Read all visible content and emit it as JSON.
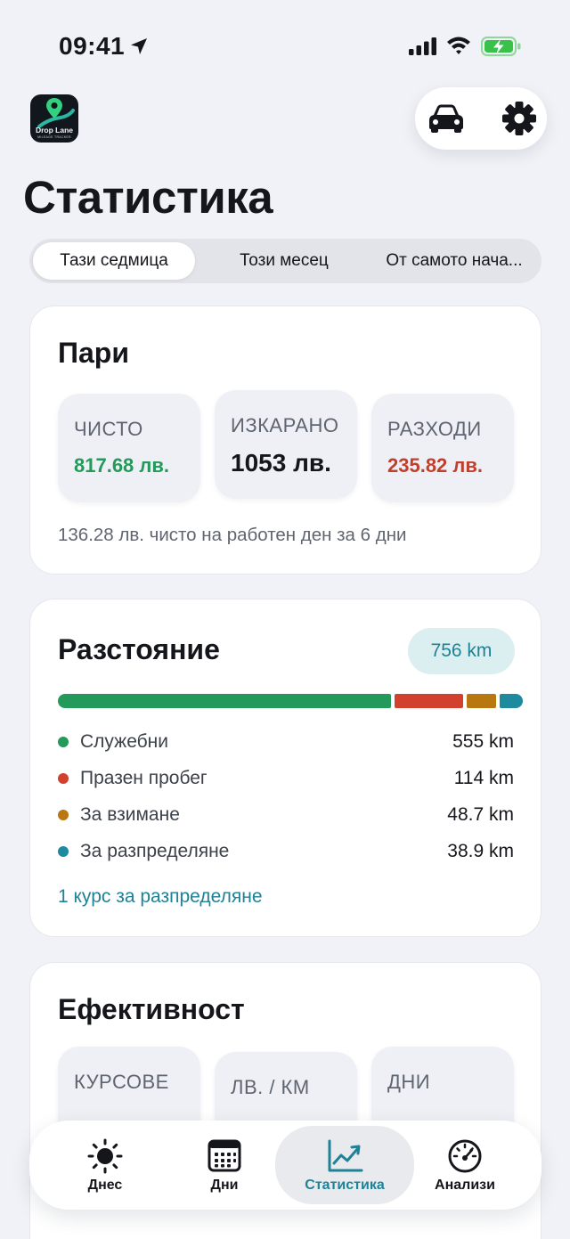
{
  "status_bar": {
    "time": "09:41"
  },
  "app": {
    "logo_name": "Drop Lane",
    "logo_subtitle": "MILEAGE TRACKER"
  },
  "page": {
    "title": "Статистика"
  },
  "period_tabs": [
    {
      "label": "Тази седмица",
      "active": true
    },
    {
      "label": "Този месец",
      "active": false
    },
    {
      "label": "От самото нача...",
      "active": false
    }
  ],
  "money": {
    "title": "Пари",
    "net_label": "ЧИСТО",
    "net_value": "817.68 лв.",
    "earned_label": "ИЗКАРАНО",
    "earned_value": "1053 лв.",
    "expenses_label": "РАЗХОДИ",
    "expenses_value": "235.82 лв.",
    "footnote": "136.28 лв. чисто на работен ден за 6 дни"
  },
  "distance": {
    "title": "Разстояние",
    "total": "756 km",
    "items": [
      {
        "label": "Служебни",
        "value": "555 km",
        "km": 555,
        "color": "#239a5a"
      },
      {
        "label": "Празен пробег",
        "value": "114 km",
        "km": 114,
        "color": "#d2402e"
      },
      {
        "label": "За взимане",
        "value": "48.7 km",
        "km": 48.7,
        "color": "#b8780f"
      },
      {
        "label": "За разпределяне",
        "value": "38.9 km",
        "km": 38.9,
        "color": "#1d8aa0"
      }
    ],
    "link": "1 курс за разпределяне"
  },
  "efficiency": {
    "title": "Ефективност",
    "trips_label": "КУРСОВЕ",
    "per_km_label": "ЛВ. / КМ",
    "days_label": "ДНИ"
  },
  "tabs": [
    {
      "label": "Днес",
      "icon": "sun-icon"
    },
    {
      "label": "Дни",
      "icon": "calendar-icon"
    },
    {
      "label": "Статистика",
      "icon": "chart-icon",
      "active": true
    },
    {
      "label": "Анализи",
      "icon": "gauge-icon"
    }
  ],
  "colors": {
    "accent": "#1f8296",
    "positive": "#239a5a",
    "negative": "#c0402c",
    "background": "#f1f2f7"
  }
}
